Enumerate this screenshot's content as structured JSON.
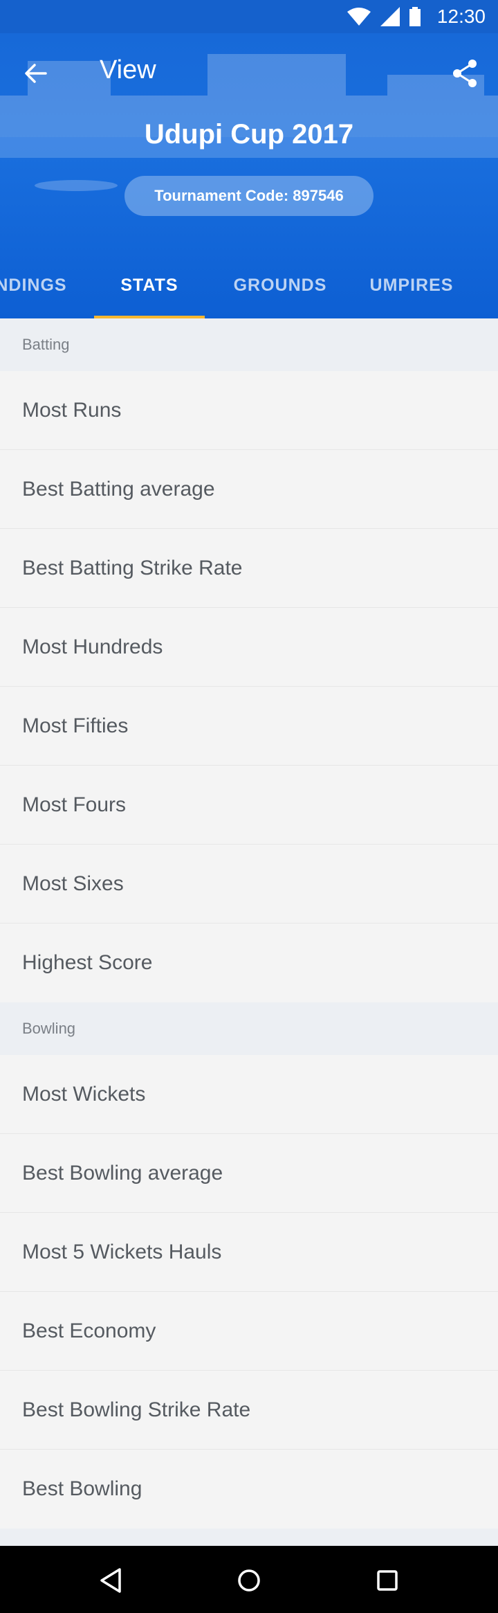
{
  "status_bar": {
    "time": "12:30"
  },
  "appbar": {
    "title": "View",
    "back_icon": "arrow-left-icon",
    "share_icon": "share-icon"
  },
  "tournament": {
    "name": "Udupi Cup 2017",
    "code_label": "Tournament Code: 897546"
  },
  "tabs": [
    {
      "label": "NDINGS",
      "active": false
    },
    {
      "label": "STATS",
      "active": true
    },
    {
      "label": "GROUNDS",
      "active": false
    },
    {
      "label": "UMPIRES",
      "active": false
    }
  ],
  "colors": {
    "primary": "#1a6fde",
    "indicator": "#f5b731"
  },
  "sections": [
    {
      "title": "Batting",
      "items": [
        "Most Runs",
        "Best Batting average",
        "Best Batting Strike Rate",
        "Most Hundreds",
        "Most Fifties",
        "Most Fours",
        "Most Sixes",
        "Highest Score"
      ]
    },
    {
      "title": "Bowling",
      "items": [
        "Most Wickets",
        "Best Bowling average",
        "Most 5 Wickets Hauls",
        "Best Economy",
        "Best Bowling Strike Rate",
        "Best Bowling"
      ]
    }
  ],
  "navbar": {
    "icons": [
      "back-triangle-icon",
      "home-circle-icon",
      "recents-square-icon"
    ]
  }
}
